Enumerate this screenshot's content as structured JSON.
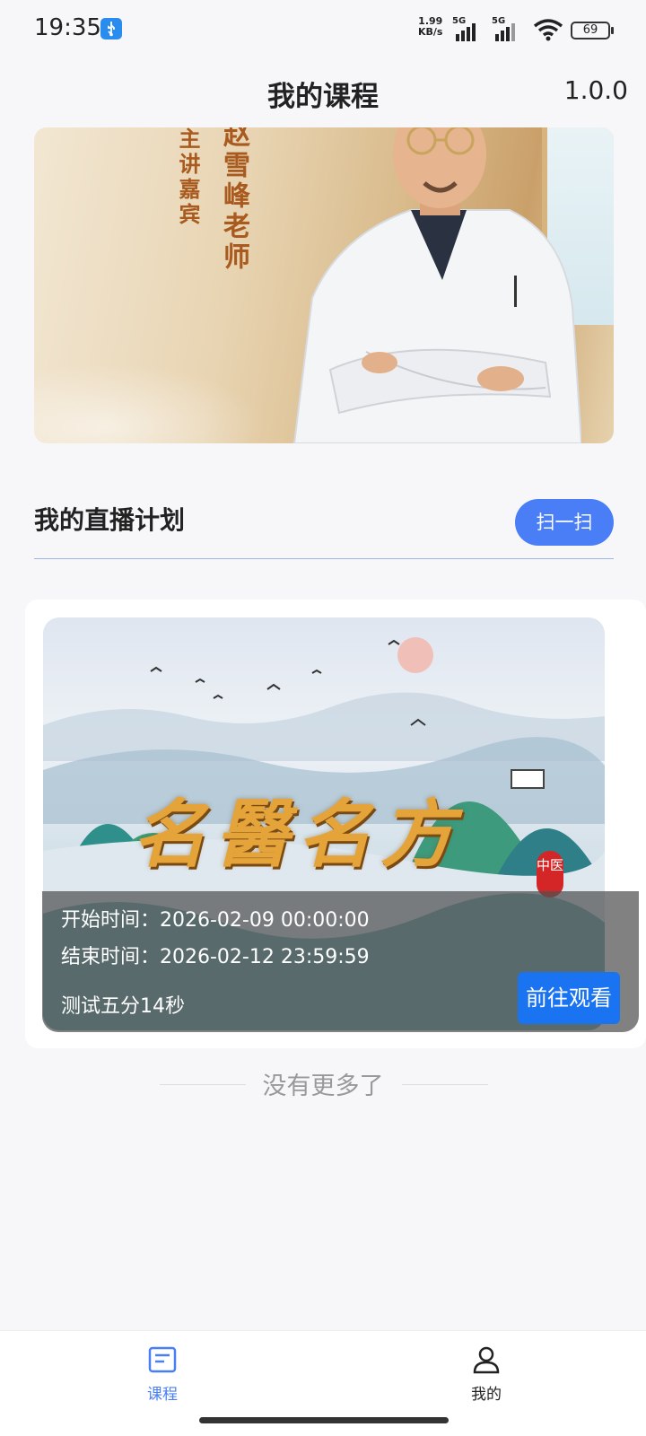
{
  "status_bar": {
    "time": "19:35",
    "net_speed_value": "1.99",
    "net_speed_unit": "KB/s",
    "sim1_label": "5G",
    "sim2_label": "5G",
    "battery": "69",
    "icons": [
      "usb-icon",
      "signal-icon",
      "wifi-icon",
      "battery-icon"
    ]
  },
  "header": {
    "title": "我的课程",
    "version": "1.0.0"
  },
  "banner": {
    "label_host": "主讲嘉宾",
    "label_teacher": "赵雪峰老师"
  },
  "live_section": {
    "title": "我的直播计划",
    "scan_label": "扫一扫"
  },
  "courses": [
    {
      "poster_title": "名醫名方",
      "poster_seal": "中医",
      "start_time": "开始时间：2026-02-09 00:00:00",
      "end_time": "结束时间：2026-02-12 23:59:59",
      "name": "测试五分14秒",
      "watch_label": "前往观看"
    }
  ],
  "no_more_text": "没有更多了",
  "tab_bar": {
    "items": [
      {
        "label": "课程",
        "icon": "course-icon",
        "active": true
      },
      {
        "label": "我的",
        "icon": "profile-icon",
        "active": false
      }
    ],
    "active_color": "#4a7ef7"
  },
  "colors": {
    "primary": "#4a7ef7",
    "watch_button": "#1a73f0",
    "background": "#f7f7f9"
  }
}
